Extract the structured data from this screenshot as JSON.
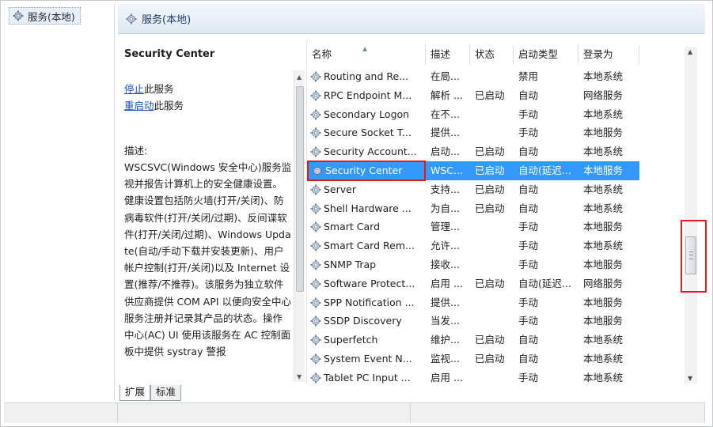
{
  "tree": {
    "root_label": "服务(本地)"
  },
  "pane": {
    "title": "服务(本地)"
  },
  "desc": {
    "service_name": "Security Center",
    "stop_link": "停止",
    "stop_suffix": "此服务",
    "restart_link": "重启动",
    "restart_suffix": "此服务",
    "desc_label": "描述:",
    "desc_body": "WSCSVC(Windows 安全中心)服务监视并报告计算机上的安全健康设置。健康设置包括防火墙(打开/关闭)、防病毒软件(打开/关闭/过期)、反间谍软件(打开/关闭/过期)、Windows Update(自动/手动下载并安装更新)、用户帐户控制(打开/关闭)以及 Internet 设置(推荐/不推荐)。该服务为独立软件供应商提供 COM API 以便向安全中心服务注册并记录其产品的状态。操作中心(AC) UI 使用该服务在 AC 控制面板中提供 systray 警报"
  },
  "columns": {
    "name": "名称",
    "desc": "描述",
    "state": "状态",
    "startup": "启动类型",
    "logon": "登录为"
  },
  "rows": [
    {
      "name": "Routing and Re...",
      "desc": "在局...",
      "state": "",
      "startup": "禁用",
      "logon": "本地系统"
    },
    {
      "name": "RPC Endpoint M...",
      "desc": "解析 ...",
      "state": "已启动",
      "startup": "自动",
      "logon": "网络服务"
    },
    {
      "name": "Secondary Logon",
      "desc": "在不...",
      "state": "",
      "startup": "手动",
      "logon": "本地系统"
    },
    {
      "name": "Secure Socket T...",
      "desc": "提供...",
      "state": "",
      "startup": "手动",
      "logon": "本地服务"
    },
    {
      "name": "Security Account...",
      "desc": "启动...",
      "state": "已启动",
      "startup": "自动",
      "logon": "本地系统"
    },
    {
      "name": "Security Center",
      "desc": "WSC...",
      "state": "已启动",
      "startup": "自动(延迟...",
      "logon": "本地服务"
    },
    {
      "name": "Server",
      "desc": "支持...",
      "state": "已启动",
      "startup": "自动",
      "logon": "本地系统"
    },
    {
      "name": "Shell Hardware ...",
      "desc": "为自...",
      "state": "已启动",
      "startup": "自动",
      "logon": "本地系统"
    },
    {
      "name": "Smart Card",
      "desc": "管理...",
      "state": "",
      "startup": "手动",
      "logon": "本地服务"
    },
    {
      "name": "Smart Card Rem...",
      "desc": "允许...",
      "state": "",
      "startup": "手动",
      "logon": "本地系统"
    },
    {
      "name": "SNMP Trap",
      "desc": "接收...",
      "state": "",
      "startup": "手动",
      "logon": "本地服务"
    },
    {
      "name": "Software Protect...",
      "desc": "启用 ...",
      "state": "已启动",
      "startup": "自动(延迟...",
      "logon": "网络服务"
    },
    {
      "name": "SPP Notification ...",
      "desc": "提供...",
      "state": "",
      "startup": "手动",
      "logon": "本地服务"
    },
    {
      "name": "SSDP Discovery",
      "desc": "当发...",
      "state": "",
      "startup": "手动",
      "logon": "本地服务"
    },
    {
      "name": "Superfetch",
      "desc": "维护...",
      "state": "已启动",
      "startup": "自动",
      "logon": "本地系统"
    },
    {
      "name": "System Event N...",
      "desc": "监视...",
      "state": "已启动",
      "startup": "自动",
      "logon": "本地系统"
    },
    {
      "name": "Tablet PC Input ...",
      "desc": "启用 ...",
      "state": "",
      "startup": "手动",
      "logon": "本地系统"
    }
  ],
  "selected_row": 5,
  "tabs": {
    "extended": "扩展",
    "standard": "标准"
  },
  "colors": {
    "selection": "#3399ff",
    "highlight_box": "#e11a1a",
    "link": "#1a4fb8"
  },
  "icons": {
    "tree": "gear-icon",
    "header": "gear-icon",
    "row": "gear-icon"
  }
}
